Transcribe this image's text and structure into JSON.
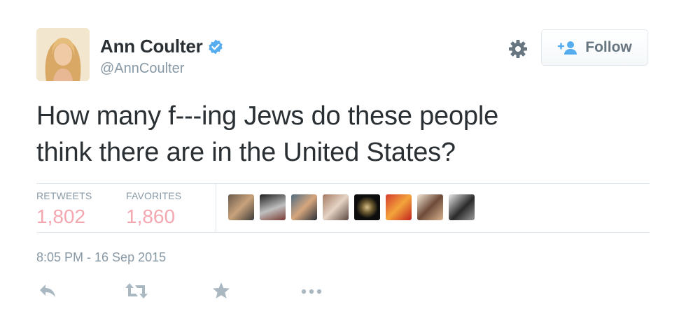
{
  "author": {
    "name": "Ann Coulter",
    "handle": "@AnnCoulter",
    "verified": true,
    "avatar_icon": "profile-photo"
  },
  "header": {
    "follow_label": "Follow",
    "gear_icon": "gear-icon",
    "follow_icon": "add-user-icon"
  },
  "tweet": {
    "text_lines": [
      "How many f---ing Jews do these people",
      "think there are in the United States?"
    ]
  },
  "stats": {
    "retweets_label": "RETWEETS",
    "retweets_count": "1,802",
    "favorites_label": "FAVORITES",
    "favorites_count": "1,860",
    "favoriter_avatars": 8
  },
  "timestamp": "8:05 PM - 16 Sep 2015",
  "actions": [
    "reply-icon",
    "retweet-icon",
    "favorite-icon",
    "more-icon"
  ],
  "colors": {
    "text": "#292f33",
    "muted": "#8899a6",
    "stat_value": "#f4a7b0",
    "verified": "#55acee",
    "border": "#e1e8ed"
  }
}
